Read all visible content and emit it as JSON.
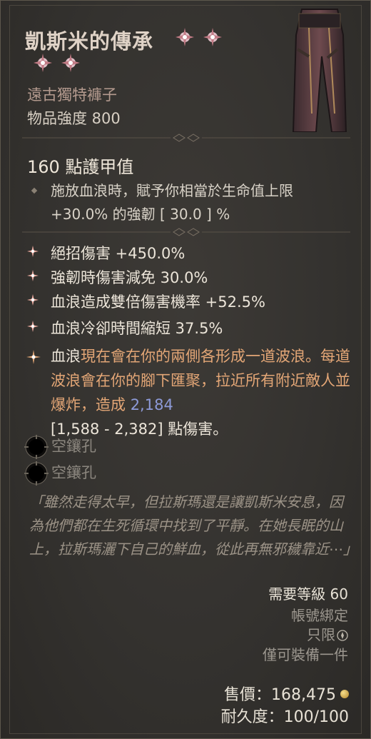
{
  "item": {
    "name": "凱斯米的傳承",
    "type": "遠古獨特褲子",
    "item_power": "物品強度 800"
  },
  "armor": "160 點護甲值",
  "implicit": "施放血浪時，賦予你相當於生命值上限 +30.0% 的強韌 [ 30.0 ] %",
  "affixes": [
    "絕招傷害 +450.0%",
    "強韌時傷害減免 30.0%",
    "血浪造成雙倍傷害機率 +52.5%",
    "血浪冷卻時間縮短 37.5%"
  ],
  "aspect": {
    "part1": "血浪",
    "part2": "現在會在你的兩側各形成一道波浪。每道波浪會在你的腳下匯聚，拉近所有附近敵人並爆炸，造成 ",
    "value": "2,184",
    "part3": "[1,588 - 2,382] 點傷害。"
  },
  "sockets": [
    "空鑲孔",
    "空鑲孔"
  ],
  "flavor": "「雖然走得太早，但拉斯瑪還是讓凱斯米安息，因為他們都在生死循環中找到了平靜。在她長眠的山上，拉斯瑪灑下自己的鮮血，從此再無邪穢靠近⋯」",
  "requirements": {
    "level": "需要等級 60",
    "bound": "帳號綁定",
    "only": "只限",
    "equip": "僅可裝備一件"
  },
  "price": "售價：168,475",
  "durability": "耐久度：100/100",
  "colors": {
    "title": "#dfd2c6",
    "subtitle": "#b59b8f",
    "aspect_highlight": "#e3a676",
    "value_blue": "#8d9ad8",
    "affix_icon": "#e8a99e"
  }
}
